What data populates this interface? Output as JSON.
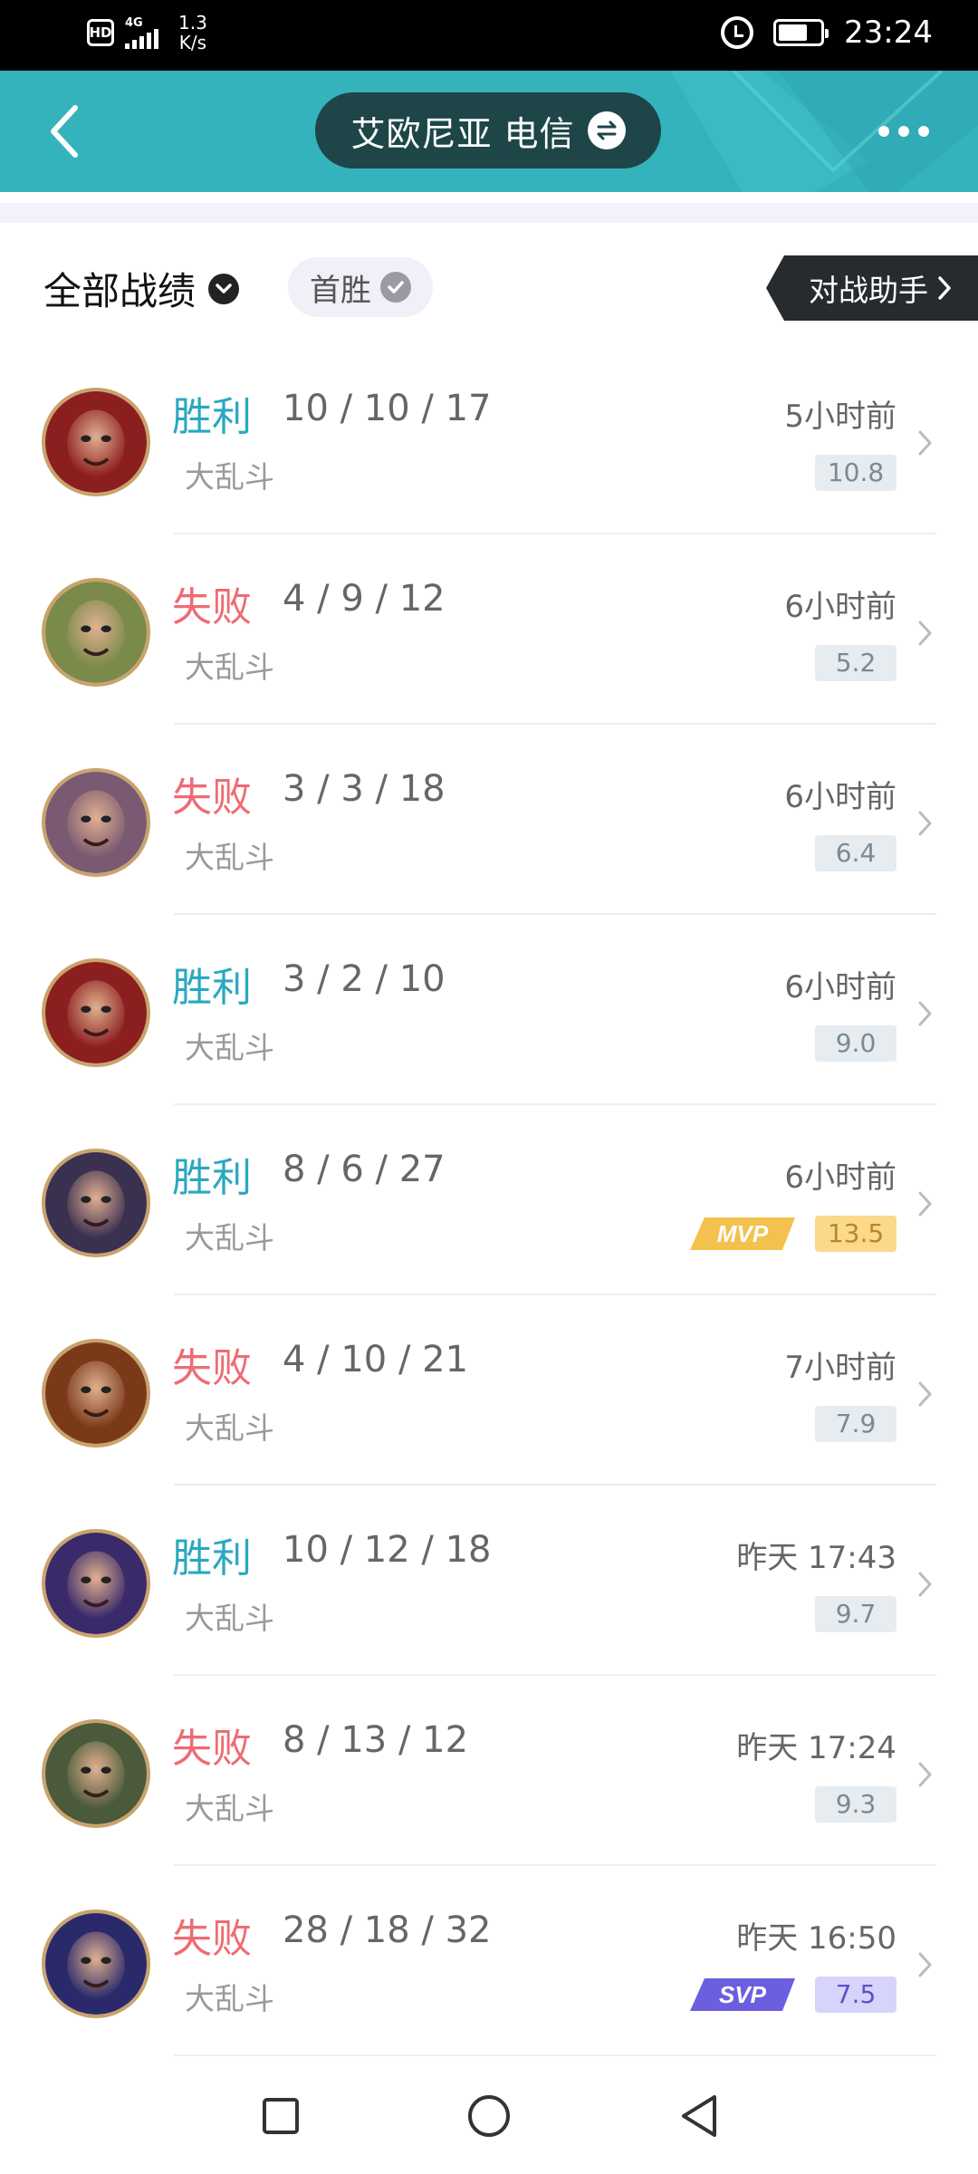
{
  "status_bar": {
    "hd_label": "HD",
    "network_label": "4G",
    "speed_value": "1.3",
    "speed_unit": "K/s",
    "time": "23:24",
    "battery_percent": 70
  },
  "header": {
    "title": "艾欧尼亚 电信",
    "back_icon": "back-arrow-icon",
    "swap_icon": "swap-icon",
    "more_icon": "more-icon",
    "accent_color": "#35b3bd"
  },
  "filters": {
    "all_records_label": "全部战绩",
    "first_win_label": "首胜",
    "assistant_label": "对战助手"
  },
  "colors": {
    "win": "#2aa8c0",
    "loss": "#ef6b73",
    "mvp": "#f3c14d",
    "svp": "#6b5fe0"
  },
  "matches": [
    {
      "result": "胜利",
      "outcome": "win",
      "kda": "10 / 10 / 17",
      "mode": "大乱斗",
      "time": "5小时前",
      "score": "10.8",
      "badge": "",
      "avatar_color": "#8b1e1e"
    },
    {
      "result": "失败",
      "outcome": "loss",
      "kda": "4 / 9 / 12",
      "mode": "大乱斗",
      "time": "6小时前",
      "score": "5.2",
      "badge": "",
      "avatar_color": "#7a8a4a"
    },
    {
      "result": "失败",
      "outcome": "loss",
      "kda": "3 / 3 / 18",
      "mode": "大乱斗",
      "time": "6小时前",
      "score": "6.4",
      "badge": "",
      "avatar_color": "#7a5a72"
    },
    {
      "result": "胜利",
      "outcome": "win",
      "kda": "3 / 2 / 10",
      "mode": "大乱斗",
      "time": "6小时前",
      "score": "9.0",
      "badge": "",
      "avatar_color": "#8b1e1e"
    },
    {
      "result": "胜利",
      "outcome": "win",
      "kda": "8 / 6 / 27",
      "mode": "大乱斗",
      "time": "6小时前",
      "score": "13.5",
      "badge": "MVP",
      "avatar_color": "#3a3050"
    },
    {
      "result": "失败",
      "outcome": "loss",
      "kda": "4 / 10 / 21",
      "mode": "大乱斗",
      "time": "7小时前",
      "score": "7.9",
      "badge": "",
      "avatar_color": "#7a3a1a"
    },
    {
      "result": "胜利",
      "outcome": "win",
      "kda": "10 / 12 / 18",
      "mode": "大乱斗",
      "time": "昨天 17:43",
      "score": "9.7",
      "badge": "",
      "avatar_color": "#3a2a6a"
    },
    {
      "result": "失败",
      "outcome": "loss",
      "kda": "8 / 13 / 12",
      "mode": "大乱斗",
      "time": "昨天 17:24",
      "score": "9.3",
      "badge": "",
      "avatar_color": "#4a5a3a"
    },
    {
      "result": "失败",
      "outcome": "loss",
      "kda": "28 / 18 / 32",
      "mode": "大乱斗",
      "time": "昨天 16:50",
      "score": "7.5",
      "badge": "SVP",
      "avatar_color": "#2a2a6a"
    }
  ],
  "nav_bar": {
    "recent_icon": "square-icon",
    "home_icon": "circle-icon",
    "back_icon": "triangle-back-icon"
  }
}
